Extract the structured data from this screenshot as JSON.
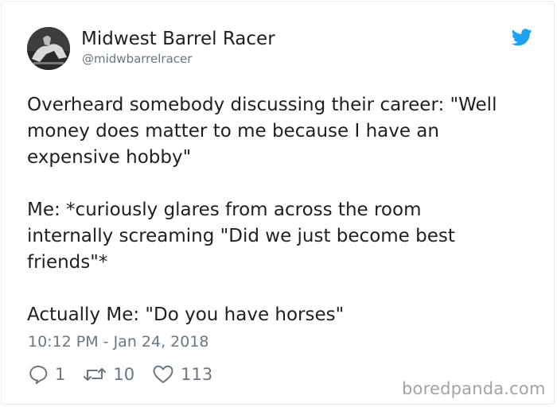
{
  "author": {
    "display_name": "Midwest Barrel Racer",
    "handle": "@midwbarrelracer"
  },
  "tweet": {
    "lines": [
      "Overheard somebody discussing their career: \"Well",
      "money does matter to me because I have an",
      "expensive hobby\"",
      "",
      "Me: *curiously glares from across the room",
      "internally screaming \"Did we just become best",
      "friends\"*",
      "",
      "Actually Me: \"Do you have horses\""
    ],
    "timestamp": "10:12 PM - Jan 24, 2018"
  },
  "actions": {
    "replies": "1",
    "retweets": "10",
    "likes": "113"
  },
  "icons": {
    "brand": "twitter-bird-icon",
    "reply": "reply-bubble-icon",
    "retweet": "retweet-icon",
    "like": "heart-icon"
  },
  "colors": {
    "brand_blue": "#1da1f2",
    "text": "#1c2022",
    "muted": "#697882",
    "border": "#e6ecf0"
  },
  "watermark": "boredpanda.com"
}
